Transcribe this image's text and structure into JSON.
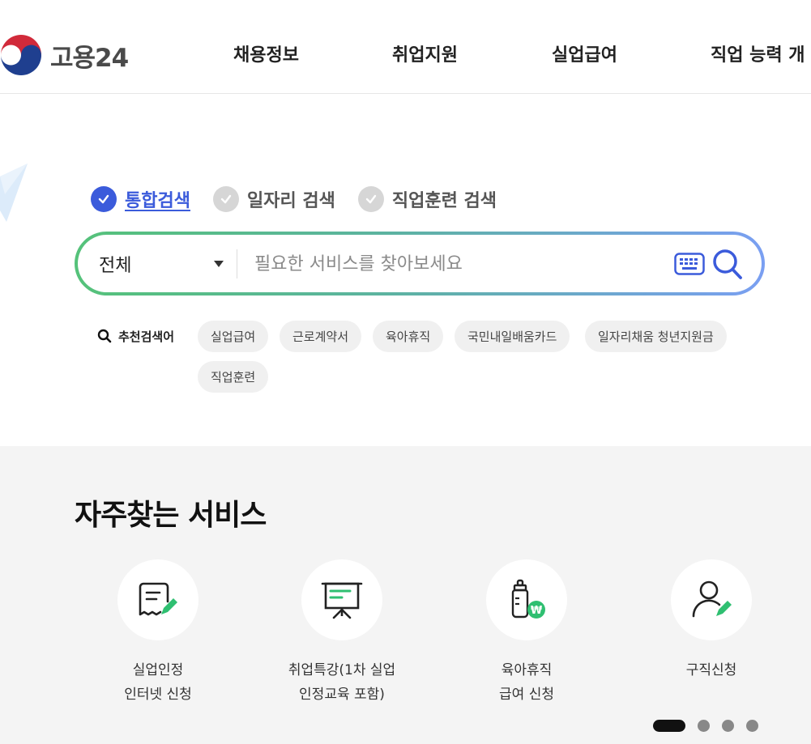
{
  "header": {
    "logo_text": "고용24",
    "logo_icon": "taegeuk-logo-icon",
    "nav": [
      "채용정보",
      "취업지원",
      "실업급여",
      "직업 능력 개"
    ]
  },
  "search": {
    "tabs": [
      {
        "label": "통합검색",
        "active": true
      },
      {
        "label": "일자리 검색",
        "active": false
      },
      {
        "label": "직업훈련 검색",
        "active": false
      }
    ],
    "scope": "전체",
    "placeholder": "필요한 서비스를 찾아보세요",
    "value": "",
    "keyboard_icon": "keyboard-icon",
    "search_icon": "search-icon",
    "gradient_colors": [
      "#55c27a",
      "#7a9ff2"
    ]
  },
  "recommended": {
    "label": "추천검색어",
    "keywords": [
      "실업급여",
      "근로계약서",
      "육아휴직",
      "국민내일배움카드",
      "일자리채움 청년지원금",
      "직업훈련"
    ]
  },
  "services": {
    "title": "자주찾는 서비스",
    "items": [
      {
        "line1": "실업인정",
        "line2": "인터넷 신청",
        "icon": "document-pen-icon"
      },
      {
        "line1": "취업특강(1차 실업",
        "line2": "인정교육 포함)",
        "icon": "presentation-board-icon"
      },
      {
        "line1": "육아휴직",
        "line2": "급여 신청",
        "icon": "baby-bottle-won-icon"
      },
      {
        "line1": "구직신청",
        "line2": "",
        "icon": "person-pen-icon"
      }
    ],
    "pagination": {
      "current": 1,
      "total": 4
    }
  },
  "colors": {
    "accent": "#3b5bdb",
    "icon_green": "#2fbf71",
    "icon_dark": "#222222"
  }
}
